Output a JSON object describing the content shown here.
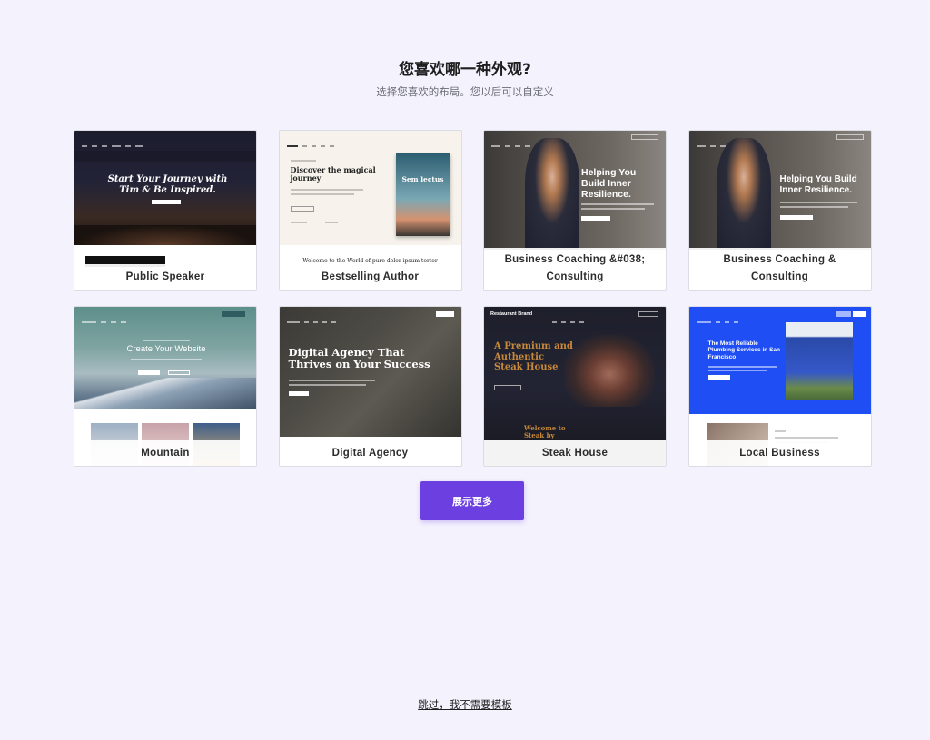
{
  "header": {
    "title": "您喜欢哪一种外观?",
    "subtitle": "选择您喜欢的布局。您以后可以自定义"
  },
  "templates": [
    {
      "label": "Public Speaker",
      "hero_heading": "Start Your Journey with Tim & Be Inspired."
    },
    {
      "label": "Bestselling Author",
      "hero_heading": "Discover the magical journey",
      "book_title": "Sem lectus",
      "footer_text": "Welcome to the World of pure dolor ipsum tortor"
    },
    {
      "label": "Business Coaching &#038; Consulting",
      "hero_heading": "Helping You Build Inner Resilience."
    },
    {
      "label": "Business Coaching & Consulting",
      "hero_heading": "Helping You Build Inner Resilience."
    },
    {
      "label": "Mountain",
      "hero_heading": "Create Your Website"
    },
    {
      "label": "Digital Agency",
      "hero_heading": "Digital Agency That Thrives on Your Success"
    },
    {
      "label": "Steak House",
      "hero_heading": "A Premium and Authentic Steak House",
      "brand": "Restaurant Brand",
      "sub_heading": "Welcome to Steak by"
    },
    {
      "label": "Local Business",
      "hero_heading": "The Most Reliable Plumbing Services in San Francisco"
    }
  ],
  "actions": {
    "show_more": "展示更多",
    "skip": "跳过，我不需要模板"
  },
  "colors": {
    "page_bg": "#f4f3fd",
    "primary_button": "#6c3fe0",
    "local_business_blue": "#1f4ef5",
    "steak_gold": "#c8893a"
  }
}
